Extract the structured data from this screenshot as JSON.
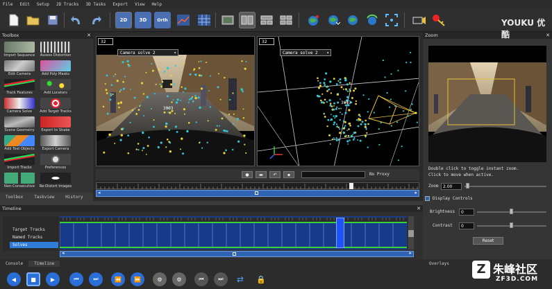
{
  "menubar": [
    "File",
    "Edit",
    "Setup",
    "2D Tracks",
    "3D Tasks",
    "Export",
    "View",
    "Help"
  ],
  "toolbar": {
    "btn_2d": "2D",
    "btn_3d": "3D",
    "btn_orth": "Orth"
  },
  "toolbox": {
    "title": "Toolbox",
    "tools": [
      {
        "label": "Import Sequence",
        "icon": "film-icon"
      },
      {
        "label": "Assess Distortion",
        "icon": "grid-icon"
      },
      {
        "label": "Edit Camera",
        "icon": "camera-icon"
      },
      {
        "label": "Add Poly Masks",
        "icon": "mask-icon"
      },
      {
        "label": "Track Features",
        "icon": "track-icon"
      },
      {
        "label": "Add Locators",
        "icon": "locator-icon"
      },
      {
        "label": "Camera Solve",
        "icon": "solve-icon"
      },
      {
        "label": "Add Target Tracks",
        "icon": "target-icon"
      },
      {
        "label": "Scene Geometry",
        "icon": "geometry-icon"
      },
      {
        "label": "Export to Shake",
        "icon": "shake-icon"
      },
      {
        "label": "Add Test Objects",
        "icon": "cube-icon"
      },
      {
        "label": "Export Camera",
        "icon": "export-camera-icon"
      },
      {
        "label": "Import Tracks",
        "icon": "import-tracks-icon"
      },
      {
        "label": "Preferences",
        "icon": "preferences-icon"
      },
      {
        "label": "Non-Consecutive",
        "icon": "nonconsecutive-icon"
      },
      {
        "label": "Re-Distort Images",
        "icon": "redistort-icon"
      }
    ],
    "tabs": [
      "Toolbox",
      "Taskview",
      "History"
    ]
  },
  "viewport_left": {
    "frame": "32",
    "camera": "Camera solve 2",
    "overlay_label": "3003"
  },
  "viewport_right": {
    "frame": "32",
    "camera": "Camera solve 2",
    "overlay_label": "3003"
  },
  "proxy_label": "No Proxy",
  "zoom": {
    "title": "Zoom",
    "hint_line1": "Double click to toggle instant zoom.",
    "hint_line2": "Click to move when active.",
    "zoom_label": "Zoom",
    "zoom_value": "2.00",
    "display_controls": "Display Controls",
    "brightness_label": "Brightness",
    "brightness_value": "0",
    "contrast_label": "Contrast",
    "contrast_value": "0",
    "reset_label": "Reset"
  },
  "timeline": {
    "title": "Timeline",
    "rows": [
      "Target Tracks",
      "Named Tracks",
      "Solves"
    ],
    "tabs": [
      "Console",
      "Timeline"
    ]
  },
  "overlays_tab": "Overlays",
  "watermarks": {
    "top": "YOUKU 优酷",
    "bottom_main": "朱峰社区",
    "bottom_sub": "ZF3D.COM"
  }
}
